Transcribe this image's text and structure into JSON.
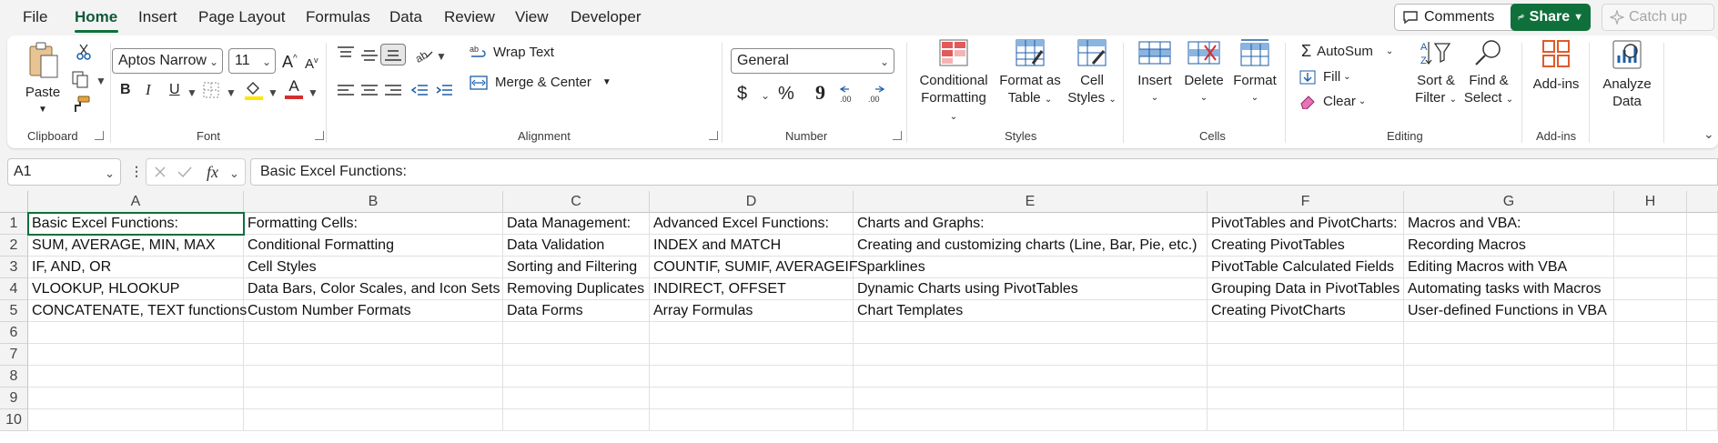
{
  "menu": {
    "tabs": [
      {
        "label": "File"
      },
      {
        "label": "Home"
      },
      {
        "label": "Insert"
      },
      {
        "label": "Page Layout"
      },
      {
        "label": "Formulas"
      },
      {
        "label": "Data"
      },
      {
        "label": "Review"
      },
      {
        "label": "View"
      },
      {
        "label": "Developer"
      }
    ],
    "active_tab": "Home",
    "comments": "Comments",
    "share": "Share",
    "catch_up": "Catch up"
  },
  "ribbon": {
    "clipboard": {
      "paste": "Paste",
      "label": "Clipboard"
    },
    "font": {
      "name": "Aptos Narrow",
      "size": "11",
      "label": "Font",
      "bold": "B",
      "italic": "I",
      "underline": "U",
      "fill_color": "#ffe600",
      "font_color": "#d32f2f"
    },
    "alignment": {
      "wrap": "Wrap Text",
      "merge": "Merge & Center",
      "label": "Alignment"
    },
    "number": {
      "format": "General",
      "label": "Number",
      "currency": "$",
      "percent": "%",
      "comma": "9"
    },
    "styles": {
      "conditional_1": "Conditional",
      "conditional_2": "Formatting",
      "format_table_1": "Format as",
      "format_table_2": "Table",
      "cell_styles_1": "Cell",
      "cell_styles_2": "Styles",
      "label": "Styles"
    },
    "cells": {
      "insert": "Insert",
      "delete": "Delete",
      "format": "Format",
      "label": "Cells"
    },
    "editing": {
      "autosum": "AutoSum",
      "fill": "Fill",
      "clear": "Clear",
      "sort_1": "Sort &",
      "sort_2": "Filter",
      "find_1": "Find &",
      "find_2": "Select",
      "label": "Editing"
    },
    "addins": {
      "addins": "Add-ins",
      "label": "Add-ins"
    },
    "analyze": {
      "line1": "Analyze",
      "line2": "Data"
    }
  },
  "formula_bar": {
    "name_box": "A1",
    "fx": "fx",
    "formula": "Basic Excel Functions:"
  },
  "sheet": {
    "columns": [
      "A",
      "B",
      "C",
      "D",
      "E",
      "F",
      "G",
      "H"
    ],
    "rows": [
      "1",
      "2",
      "3",
      "4",
      "5",
      "6",
      "7",
      "8",
      "9",
      "10"
    ],
    "cells": [
      [
        "Basic Excel Functions:",
        "Formatting Cells:",
        "Data Management:",
        "Advanced Excel Functions:",
        "Charts and Graphs:",
        "PivotTables and PivotCharts:",
        "Macros and VBA:",
        ""
      ],
      [
        "SUM, AVERAGE, MIN, MAX",
        "Conditional Formatting",
        "Data Validation",
        "INDEX and MATCH",
        "Creating and customizing charts (Line, Bar, Pie, etc.)",
        "Creating PivotTables",
        "Recording Macros",
        ""
      ],
      [
        "IF, AND, OR",
        "Cell Styles",
        "Sorting and Filtering",
        "COUNTIF, SUMIF, AVERAGEIF",
        "Sparklines",
        "PivotTable Calculated Fields",
        "Editing Macros with VBA",
        ""
      ],
      [
        "VLOOKUP, HLOOKUP",
        "Data Bars, Color Scales, and Icon Sets",
        "Removing Duplicates",
        "INDIRECT, OFFSET",
        "Dynamic Charts using PivotTables",
        "Grouping Data in PivotTables",
        "Automating tasks with Macros",
        ""
      ],
      [
        "CONCATENATE, TEXT functions",
        "Custom Number Formats",
        "Data Forms",
        "Array Formulas",
        "Chart Templates",
        "Creating PivotCharts",
        "User-defined Functions in VBA",
        ""
      ]
    ]
  }
}
